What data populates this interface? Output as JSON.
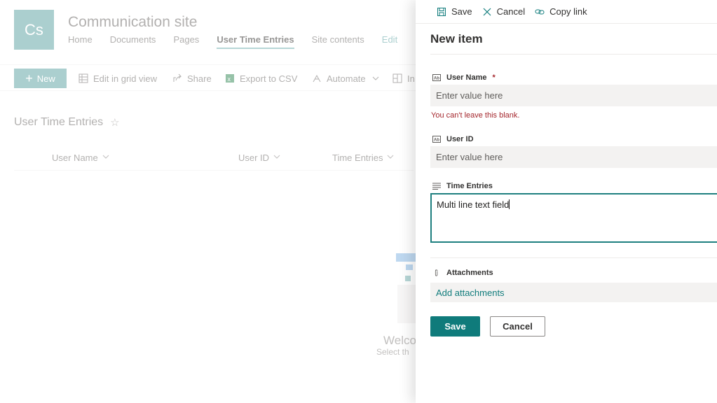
{
  "site": {
    "logo_text": "Cs",
    "title": "Communication site",
    "nav": [
      "Home",
      "Documents",
      "Pages",
      "User Time Entries",
      "Site contents",
      "Edit"
    ],
    "active_nav": "User Time Entries"
  },
  "command_bar": {
    "new_label": "New",
    "edit_grid_label": "Edit in grid view",
    "share_label": "Share",
    "export_label": "Export to CSV",
    "automate_label": "Automate",
    "integrate_label_fragment": "In"
  },
  "list": {
    "title": "User Time Entries",
    "columns": [
      "User Name",
      "User ID",
      "Time Entries"
    ],
    "empty_title_fragment": "Welco",
    "empty_sub_fragment": "Select th"
  },
  "panel": {
    "toolbar": {
      "save_label": "Save",
      "cancel_label": "Cancel",
      "copy_link_label": "Copy link"
    },
    "heading": "New item",
    "fields": {
      "user_name": {
        "label": "User Name",
        "required_mark": "*",
        "placeholder": "Enter value here",
        "error": "You can't leave this blank."
      },
      "user_id": {
        "label": "User ID",
        "placeholder": "Enter value here"
      },
      "time_entries": {
        "label": "Time Entries",
        "value": "Multi line text field"
      },
      "attachments": {
        "label": "Attachments",
        "link": "Add attachments"
      }
    },
    "save_button": "Save",
    "cancel_button": "Cancel"
  },
  "colors": {
    "accent": "#0f7b7b",
    "error": "#a4262c",
    "logo_bg": "#7fb5b5"
  }
}
